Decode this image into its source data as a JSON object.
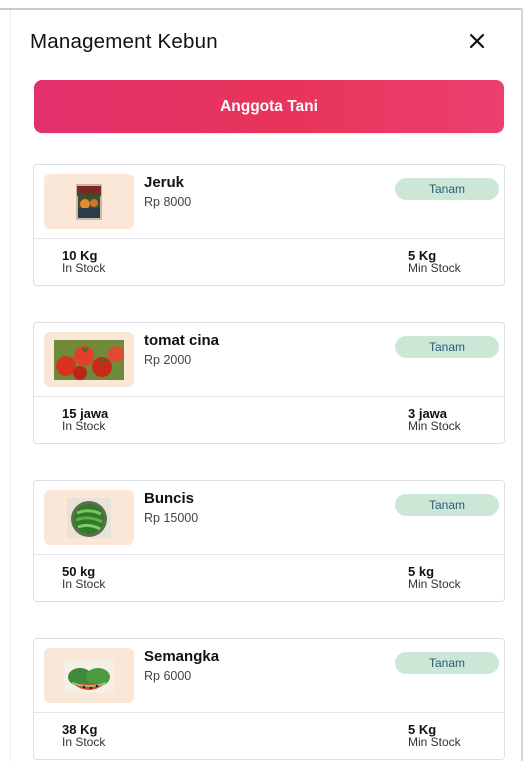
{
  "header": {
    "title": "Management Kebun",
    "close_icon": "close-icon"
  },
  "cta": {
    "label": "Anggota Tani"
  },
  "items": [
    {
      "name": "Jeruk",
      "price": "Rp 8000",
      "status": "Tanam",
      "in_stock": "10 Kg",
      "in_stock_label": "In Stock",
      "min_stock": "5 Kg",
      "min_stock_label": "Min Stock",
      "thumb_icon": "orange-photo-icon"
    },
    {
      "name": "tomat cina",
      "price": "Rp 2000",
      "status": "Tanam",
      "in_stock": "15 jawa",
      "in_stock_label": "In Stock",
      "min_stock": "3 jawa",
      "min_stock_label": "Min Stock",
      "thumb_icon": "tomato-photo-icon"
    },
    {
      "name": "Buncis",
      "price": "Rp 15000",
      "status": "Tanam",
      "in_stock": "50 kg",
      "in_stock_label": "In Stock",
      "min_stock": "5 kg",
      "min_stock_label": "Min Stock",
      "thumb_icon": "green-bean-photo-icon"
    },
    {
      "name": "Semangka",
      "price": "Rp 6000",
      "status": "Tanam",
      "in_stock": "38 Kg",
      "in_stock_label": "In Stock",
      "min_stock": "5 Kg",
      "min_stock_label": "Min Stock",
      "thumb_icon": "watermelon-photo-icon"
    }
  ],
  "colors": {
    "primary_gradient_start": "#e1306c",
    "primary_gradient_end": "#ec3f6f",
    "badge_bg": "#cde7d7",
    "badge_text": "#2b5a7a",
    "thumb_bg": "#fbe7d7"
  }
}
